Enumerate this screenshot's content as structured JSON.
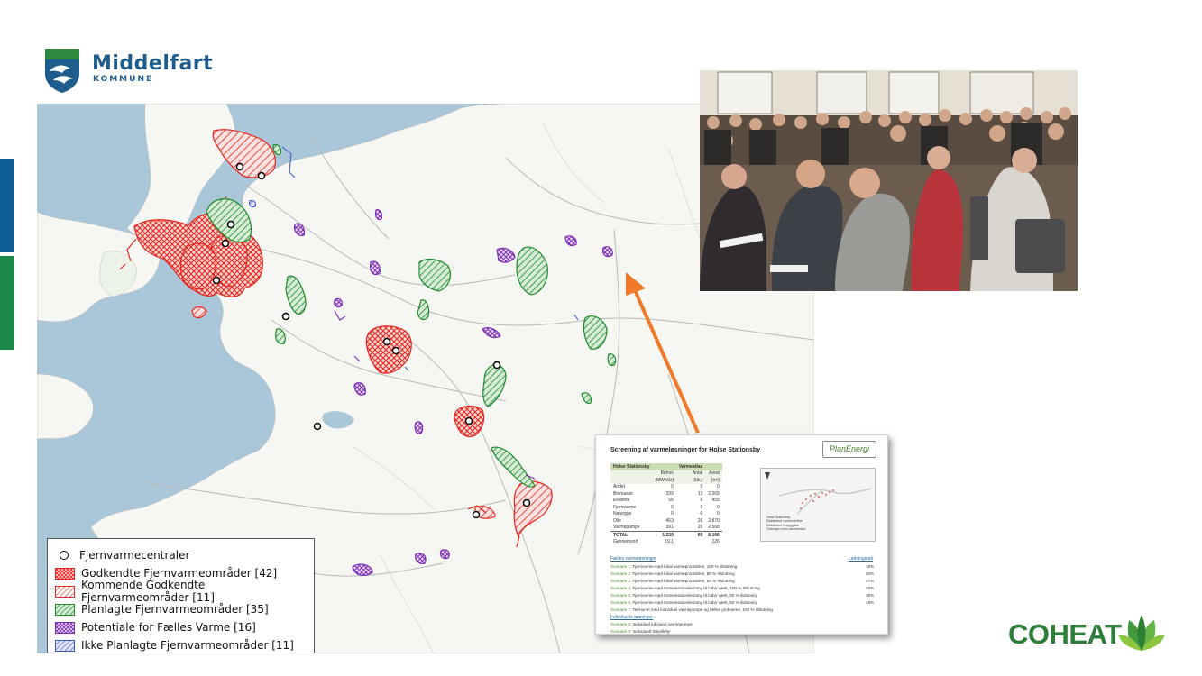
{
  "brand": {
    "name": "Middelfart",
    "sub": "KOMMUNE",
    "colors": {
      "blue": "#0f5f96",
      "green": "#1d8a4a",
      "text": "#1f5d8d"
    }
  },
  "legend": {
    "items": [
      {
        "label": "Fjernvarmecentraler",
        "icon": "plant-circle-icon"
      },
      {
        "label": "Godkendte Fjernvarmeområder [42]",
        "color": "#e3271e",
        "icon": "crosshatch-red-icon"
      },
      {
        "label": "Kommende Godkendte Fjernvarmeområder [11]",
        "color": "#e3271e",
        "icon": "hatch-red-icon"
      },
      {
        "label": "Planlagte Fjernvarmeområder [35]",
        "color": "#1f8a2e",
        "icon": "hatch-green-icon"
      },
      {
        "label": "Potentiale for Fælles Varme [16]",
        "color": "#7b2fb3",
        "icon": "crosshatch-purple-icon"
      },
      {
        "label": "Ikke Planlagte Fjernvarmeområder [11]",
        "color": "#3a55c8",
        "icon": "hatch-blue-icon"
      }
    ]
  },
  "arrow": {
    "color": "#f07a2a"
  },
  "report": {
    "title": "Screening af varmeløsninger for Holse Stationsby",
    "logo": "PlanEnergi",
    "table": {
      "header": [
        "Holse Stationsby",
        "",
        "Varmeatlas",
        ""
      ],
      "subheader": [
        "",
        "Behov",
        "Antal",
        "Areal"
      ],
      "units": [
        "",
        "[MWh/år]",
        "[Stk.]",
        "[m²]"
      ],
      "rows": [
        [
          "Andet",
          "0",
          "0",
          "0"
        ],
        [
          "Biomasse",
          "339",
          "13",
          "2.269"
        ],
        [
          "Elvarme",
          "56",
          "6",
          "459"
        ],
        [
          "Fjernvarme",
          "0",
          "0",
          "0"
        ],
        [
          "Naturgas",
          "0",
          "0",
          "0"
        ],
        [
          "Olie",
          "453",
          "26",
          "2.870"
        ],
        [
          "Varmepumpe",
          "391",
          "20",
          "2.568"
        ]
      ],
      "total": [
        "TOTAL",
        "1.239",
        "65",
        "8.166"
      ],
      "avg": [
        "Gennemsnit",
        "19,1",
        "",
        "126"
      ]
    },
    "map_legend": [
      "Holse Stationsby",
      "Middelstort varmeområde",
      "Middelstort bebyggelse",
      "Forbruger med varmebehov"
    ],
    "scenarios_heading": "Fælles varmeløsninger",
    "share_heading": "Ledningstab",
    "scenarios": [
      {
        "id": "Scenarie 1:",
        "text": "Fjernvarme med lokal varmeproduktion, 100 % tilslutning",
        "share": "18%"
      },
      {
        "id": "Scenarie 2:",
        "text": "Fjernvarme med lokal varmeproduktion, 80 % tilslutning",
        "share": "20%"
      },
      {
        "id": "Scenarie 3:",
        "text": "Fjernvarme med lokal varmeproduktion, 50 % tilslutning",
        "share": "27%"
      },
      {
        "id": "Scenarie 4:",
        "text": "Fjernvarme med transmissionsledning til nabo værk, 100 % tilslutning",
        "share": "33%"
      },
      {
        "id": "Scenarie 5:",
        "text": "Fjernvarme med transmissionsledning til nabo værk, 80 % tilslutning",
        "share": "38%"
      },
      {
        "id": "Scenarie 6:",
        "text": "Fjernvarme med transmissionsledning til nabo værk, 50 % tilslutning",
        "share": "48%"
      },
      {
        "id": "Scenarie 7:",
        "text": "Termonet med individuel varmepumpe og fælles jordvarme, 100 % tilslutning",
        "share": ""
      }
    ],
    "individual_heading": "Individuelle løsninger",
    "individual": [
      {
        "id": "Scenarie 8:",
        "text": "Individuel luft/vand varmepumpe"
      },
      {
        "id": "Scenarie 9:",
        "text": "Individuelt træpillefyr"
      }
    ]
  },
  "coheat": {
    "text": "COHEAT",
    "color": "#2e7d3a"
  }
}
